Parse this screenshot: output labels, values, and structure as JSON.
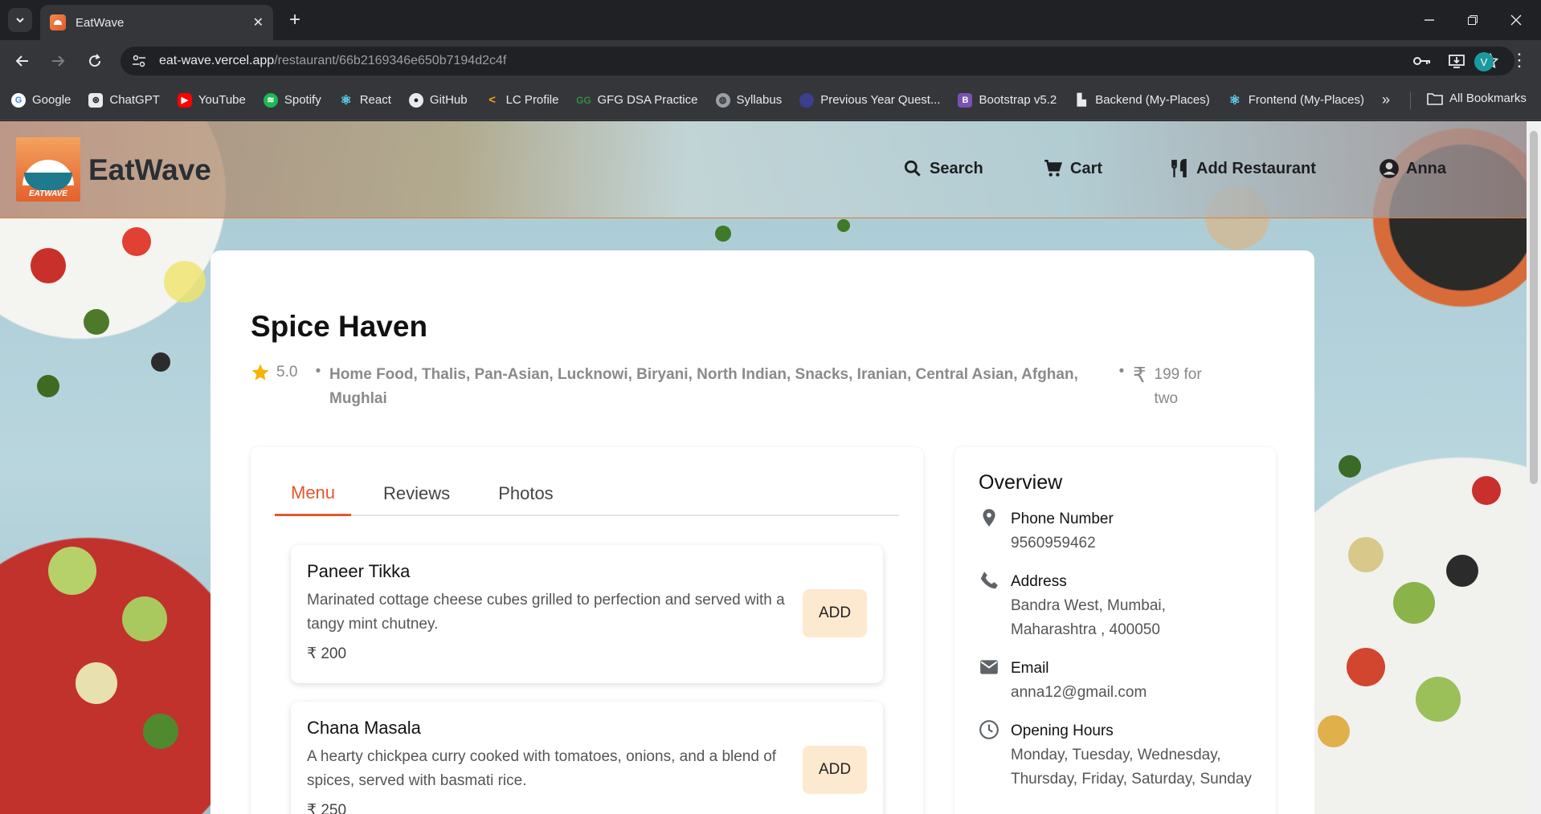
{
  "browser": {
    "tab_title": "EatWave",
    "url_host": "eat-wave.vercel.app",
    "url_path": "/restaurant/66b2169346e650b7194d2c4f",
    "profile_initial": "V",
    "bookmarks": [
      {
        "label": "Google",
        "icon": "google-icon",
        "color": "#4285f4"
      },
      {
        "label": "ChatGPT",
        "icon": "chatgpt-icon",
        "color": "#e8eaed"
      },
      {
        "label": "YouTube",
        "icon": "youtube-icon",
        "color": "#ff0000"
      },
      {
        "label": "Spotify",
        "icon": "spotify-icon",
        "color": "#1db954"
      },
      {
        "label": "React",
        "icon": "react-icon",
        "color": "#61dafb"
      },
      {
        "label": "GitHub",
        "icon": "github-icon",
        "color": "#e8eaed"
      },
      {
        "label": "LC Profile",
        "icon": "leetcode-icon",
        "color": "#f89f1b"
      },
      {
        "label": "GFG DSA Practice",
        "icon": "gfg-icon",
        "color": "#2f8d46"
      },
      {
        "label": "Syllabus",
        "icon": "globe-icon",
        "color": "#9aa0a6"
      },
      {
        "label": "Previous Year Quest...",
        "icon": "circle-icon",
        "color": "#3b3f8f"
      },
      {
        "label": "Bootstrap v5.2",
        "icon": "bootstrap-icon",
        "color": "#7952b3"
      },
      {
        "label": "Backend (My-Places)",
        "icon": "places-icon",
        "color": "#e8eaed"
      },
      {
        "label": "Frontend (My-Places)",
        "icon": "react-icon",
        "color": "#61dafb"
      }
    ],
    "all_bookmarks": "All Bookmarks"
  },
  "site": {
    "brand": "EatWave",
    "logo_text": "EATWAVE",
    "nav": {
      "search": "Search",
      "cart": "Cart",
      "add_restaurant": "Add Restaurant",
      "user": "Anna"
    }
  },
  "restaurant": {
    "name": "Spice Haven",
    "rating": "5.0",
    "cuisines": "Home Food, Thalis, Pan-Asian, Lucknowi, Biryani, North Indian, Snacks, Iranian, Central Asian, Afghan, Mughlai",
    "currency_symbol": "₹",
    "cost": "199 for two",
    "tabs": [
      "Menu",
      "Reviews",
      "Photos"
    ],
    "active_tab": "Menu",
    "add_label": "ADD",
    "menu": [
      {
        "name": "Paneer Tikka",
        "description": "Marinated cottage cheese cubes grilled to perfection and served with a tangy mint chutney.",
        "price": "₹ 200"
      },
      {
        "name": "Chana Masala",
        "description": "A hearty chickpea curry cooked with tomatoes, onions, and a blend of spices, served with basmati rice.",
        "price": "₹ 250"
      }
    ],
    "overview": {
      "title": "Overview",
      "phone_label": "Phone Number",
      "phone": "9560959462",
      "address_label": "Address",
      "address": "Bandra West, Mumbai, Maharashtra , 400050",
      "email_label": "Email",
      "email": "anna12@gmail.com",
      "hours_label": "Opening Hours",
      "hours": "Monday, Tuesday, Wednesday, Thursday, Friday, Saturday, Sunday"
    }
  },
  "colors": {
    "accent": "#e4572e",
    "add_button_bg": "#fde9cf",
    "star": "#f5b400"
  }
}
